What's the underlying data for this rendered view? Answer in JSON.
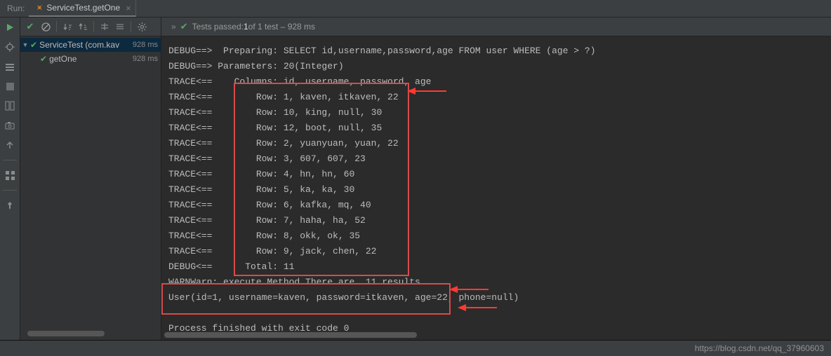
{
  "header": {
    "run_label": "Run:",
    "tab_title": "ServiceTest.getOne"
  },
  "gutter_icons": [
    "play",
    "bug",
    "stack",
    "stop",
    "layout",
    "camera",
    "open",
    "sep",
    "grid",
    "sep",
    "pin"
  ],
  "toolbar_icons": [
    "ok",
    "cancel",
    "sort-down",
    "sort-up",
    "expand",
    "collapse",
    "gear"
  ],
  "tree": {
    "root": {
      "label": "ServiceTest (com.kav",
      "time": "928 ms"
    },
    "child": {
      "label": "getOne",
      "time": "928 ms"
    }
  },
  "status": {
    "fast_forward": "»",
    "text_prefix": "Tests passed: ",
    "passed": "1",
    "of_text": " of 1 test – 928 ms"
  },
  "console_lines": [
    "DEBUG==>  Preparing: SELECT id,username,password,age FROM user WHERE (age > ?) ",
    "DEBUG==> Parameters: 20(Integer)",
    "TRACE<==    Columns: id, username, password, age",
    "TRACE<==        Row: 1, kaven, itkaven, 22",
    "TRACE<==        Row: 10, king, null, 30",
    "TRACE<==        Row: 12, boot, null, 35",
    "TRACE<==        Row: 2, yuanyuan, yuan, 22",
    "TRACE<==        Row: 3, 607, 607, 23",
    "TRACE<==        Row: 4, hn, hn, 60",
    "TRACE<==        Row: 5, ka, ka, 30",
    "TRACE<==        Row: 6, kafka, mq, 40",
    "TRACE<==        Row: 7, haha, ha, 52",
    "TRACE<==        Row: 8, okk, ok, 35",
    "TRACE<==        Row: 9, jack, chen, 22",
    "DEBUG<==      Total: 11",
    "WARNWarn: execute Method There are  11 results.",
    "User(id=1, username=kaven, password=itkaven, age=22, phone=null)",
    "",
    "Process finished with exit code 0"
  ],
  "watermark": "https://blog.csdn.net/qq_37960603",
  "colors": {
    "green": "#59a869",
    "red_box": "#d84a4a",
    "arrow": "#ff3b30"
  }
}
